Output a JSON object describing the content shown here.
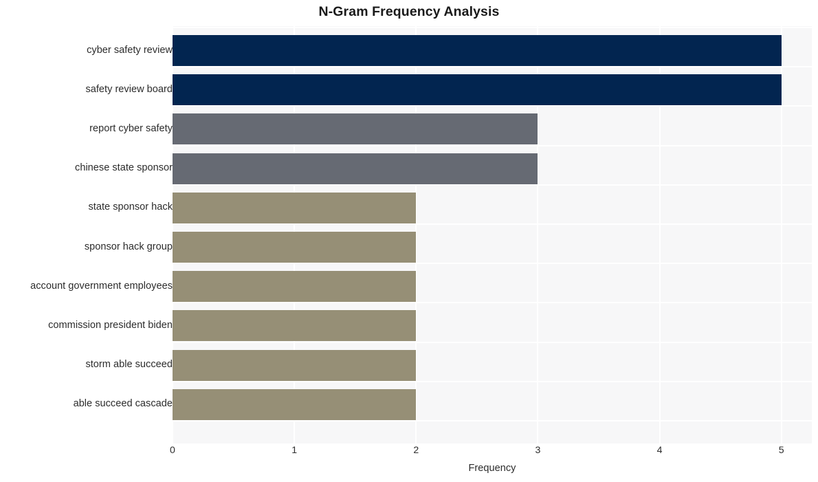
{
  "chart_data": {
    "type": "bar",
    "orientation": "horizontal",
    "title": "N-Gram Frequency Analysis",
    "xlabel": "Frequency",
    "ylabel": "",
    "xlim": [
      0,
      5.25
    ],
    "xticks": [
      "0",
      "1",
      "2",
      "3",
      "4",
      "5"
    ],
    "xtick_values": [
      0,
      1,
      2,
      3,
      4,
      5
    ],
    "grid": true,
    "legend": null,
    "categories": [
      "cyber safety review",
      "safety review board",
      "report cyber safety",
      "chinese state sponsor",
      "state sponsor hack",
      "sponsor hack group",
      "account government employees",
      "commission president biden",
      "storm able succeed",
      "able succeed cascade"
    ],
    "values": [
      5,
      5,
      3,
      3,
      2,
      2,
      2,
      2,
      2,
      2
    ],
    "bar_colors": [
      "#022550",
      "#022550",
      "#666a73",
      "#666a73",
      "#968f76",
      "#968f76",
      "#968f76",
      "#968f76",
      "#968f76",
      "#968f76"
    ],
    "plot_background": "#f7f7f8",
    "grid_color": "#ffffff",
    "title_color": "#1a1a1a",
    "tick_color": "#2c2c2c"
  }
}
